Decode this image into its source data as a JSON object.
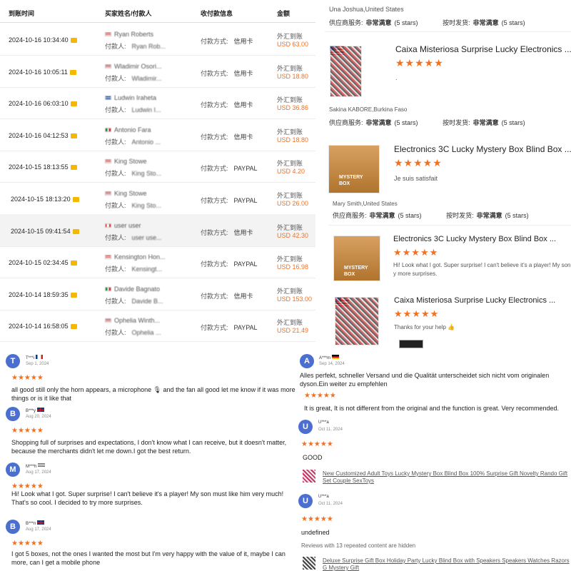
{
  "payments": {
    "headers": {
      "date": "到账时间",
      "buyer": "买家姓名/付款人",
      "method": "收付款信息",
      "amount": "金额"
    },
    "payer_prefix": "付款人:",
    "method_prefix": "付款方式:",
    "fx_label": "外汇到账",
    "rows": [
      {
        "date": "2024-10-16 10:34:40",
        "buyer": "Ryan Roberts",
        "payer": "Ryan Rob...",
        "method": "信用卡",
        "amount": "USD 63.00",
        "flag": "us"
      },
      {
        "date": "2024-10-16 10:05:11",
        "buyer": "Wladimir Osori...",
        "payer": "Wladimir...",
        "method": "信用卡",
        "amount": "USD 18.80",
        "flag": "us"
      },
      {
        "date": "2024-10-16 06:03:10",
        "buyer": "Ludwin Iraheta",
        "payer": "Ludwin I...",
        "method": "信用卡",
        "amount": "USD 36.86",
        "flag": "sv"
      },
      {
        "date": "2024-10-16 04:12:53",
        "buyer": "Antonio Fara",
        "payer": "Antonio ...",
        "method": "信用卡",
        "amount": "USD 18.80",
        "flag": "mx"
      },
      {
        "date": "2024-10-15 18:13:55",
        "buyer": "King Stowe",
        "payer": "King Sto...",
        "method": "PAYPAL",
        "amount": "USD 4.20",
        "flag": "us"
      },
      {
        "date": "2024-10-15 18:13:20",
        "buyer": "King Stowe",
        "payer": "King Sto...",
        "method": "PAYPAL",
        "amount": "USD 26.00",
        "flag": "us"
      },
      {
        "date": "2024-10-15 09:41:54",
        "buyer": "user user",
        "payer": "user use...",
        "method": "信用卡",
        "amount": "USD 42.30",
        "flag": "ca"
      },
      {
        "date": "2024-10-15 02:34:45",
        "buyer": "Kensington Hon...",
        "payer": "Kensingt...",
        "method": "PAYPAL",
        "amount": "USD 16.98",
        "flag": "us"
      },
      {
        "date": "2024-10-14 18:59:35",
        "buyer": "Davide Bagnato",
        "payer": "Davide B...",
        "method": "信用卡",
        "amount": "USD 153.00",
        "flag": "it"
      },
      {
        "date": "2024-10-14 16:58:05",
        "buyer": "Ophelia Winth...",
        "payer": "Ophelia ...",
        "method": "PAYPAL",
        "amount": "USD 21.49",
        "flag": "us"
      }
    ]
  },
  "right": {
    "ratings_label_a": "供应商服务:",
    "ratings_label_b": "按时发货:",
    "rating_value": "非常满意",
    "stars_text": "(5 stars)",
    "stars_glyph": "★★★★★",
    "reviewer_1": "Una Joshua,United States",
    "product_1_title": "Caixa Misteriosa Surprise Lucky Electronics ...",
    "product_1_review": ".",
    "reviewer_2": "Sakina KABORE,Burkina Faso",
    "product_2_title": "Electronics 3C Lucky Mystery Box Blind Box ...",
    "product_2_review": "Je suis satisfait",
    "reviewer_3": "Mary Smith,United States",
    "product_3_title": "Electronics 3C Lucky Mystery Box Blind Box ...",
    "product_3_review_1": "Hi! Look what I got. Super surprise! I can't believe it's a player! My son m",
    "product_3_review_2": "y more surprises.",
    "product_4_title": "Caixa Misteriosa Surprise Lucky Electronics ...",
    "product_4_review": "Thanks for your help 👍"
  },
  "left_reviews": [
    {
      "avatar": "T",
      "name": "T***i",
      "date": "Sep 1, 2024",
      "text": "all good still only the horn appears, a microphone 🎙 and the fan all good let me know if it was more things or is it like that"
    },
    {
      "avatar": "B",
      "name": "B***y",
      "date": "Aug 20, 2024",
      "text": "Shopping full of surprises and expectations, I don't know what I can receive, but it doesn't matter, because the merchants didn't let me down.I got the best return."
    },
    {
      "avatar": "M",
      "name": "M***h",
      "date": "Aug 17, 2024",
      "text": "Hi! Look what I got. Super surprise! I can't believe it's a player! My son must like him very much! That's so cool. I decided to try more surprises."
    },
    {
      "avatar": "B",
      "name": "B***n",
      "date": "Aug 17, 2024",
      "text": "I got 5 boxes, not the ones I wanted the most but I'm very happy with the value of it, maybe I can more, can I get a mobile phone"
    }
  ],
  "right_reviews": {
    "r1": {
      "avatar": "A",
      "name": "A***m",
      "date": "Sep 14, 2024",
      "text_de": "Alles perfekt, schneller Versand und die Qualität unterscheidet sich nicht vom originalen dyson.Ein weiter zu empfehlen",
      "text_en": "It is great, It is not different from the original and the function is great. Very recommended."
    },
    "r2": {
      "avatar": "U",
      "name": "U***a",
      "date": "Oct 11, 2024",
      "text": "GOOD",
      "link": "New Customized Adult Toys Lucky Mystery Box Blind Box 100% Surprise Gift Novelty Rando Gift Set Couple SexToys"
    },
    "r3": {
      "avatar": "U",
      "name": "U***a",
      "date": "Oct 11, 2024",
      "text": "undefined",
      "hidden_note": "Reviews with 13 repeated content are hidden",
      "link": "Deluxe Surprise Gift Box Holiday Party Lucky Blind Box with Speakers Speakers Watches Razors G Mystery Gift"
    }
  },
  "colors": {
    "accent": "#f37021",
    "avatar": "#4b6ed1"
  }
}
